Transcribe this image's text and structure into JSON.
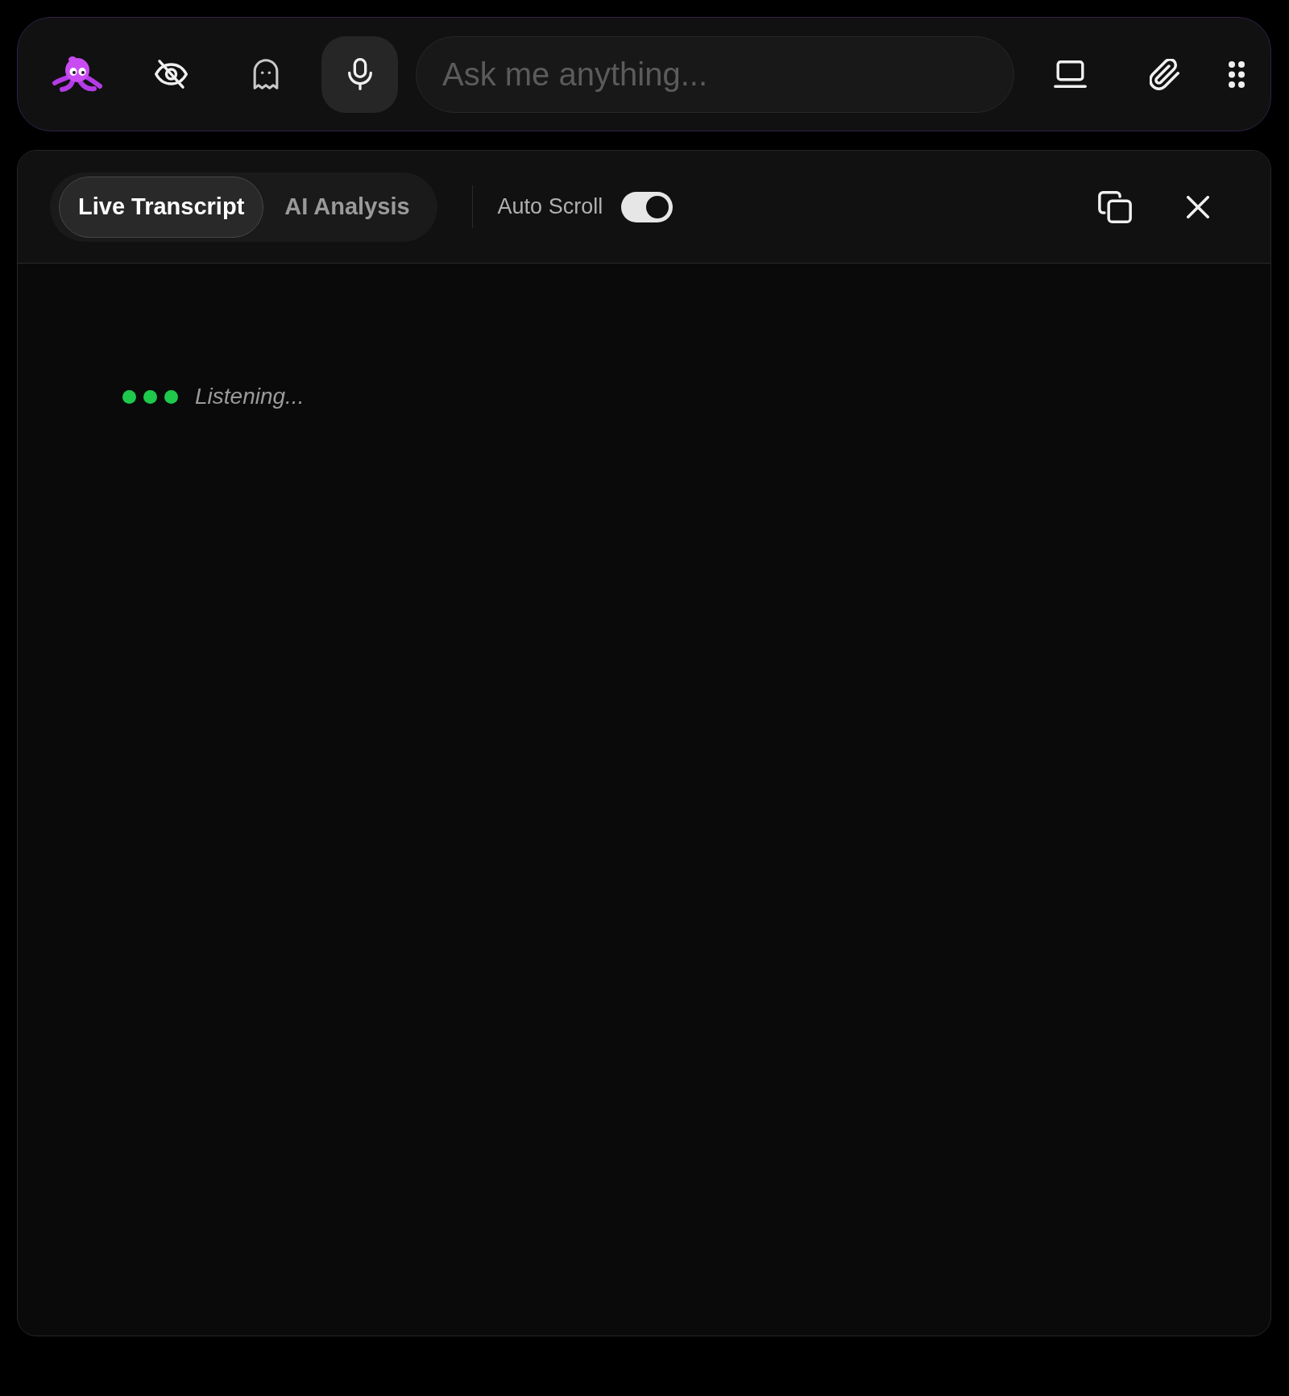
{
  "toolbar": {
    "microphone": {
      "on": true
    },
    "input": {
      "placeholder": "Ask me anything..."
    }
  },
  "panel": {
    "tabs": [
      {
        "label": "Live Transcript",
        "selected": true
      },
      {
        "label": "AI Analysis",
        "selected": false
      }
    ],
    "auto_scroll": {
      "label": "Auto Scroll",
      "on": true
    },
    "transcript": {
      "status": "Listening..."
    }
  }
}
